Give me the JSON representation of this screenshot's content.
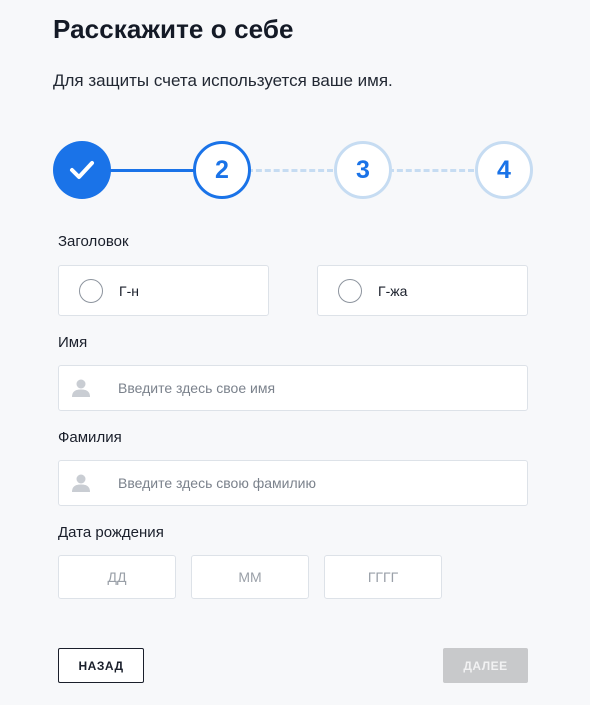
{
  "header": {
    "title": "Расскажите о себе",
    "subtitle": "Для защиты счета используется ваше имя."
  },
  "stepper": {
    "steps": [
      {
        "label": "",
        "state": "completed",
        "icon": "check-icon"
      },
      {
        "label": "2",
        "state": "current"
      },
      {
        "label": "3",
        "state": "upcoming"
      },
      {
        "label": "4",
        "state": "upcoming"
      }
    ],
    "accent_color": "#1a73e8",
    "inactive_color": "#c6dcf2"
  },
  "form": {
    "title_label": "Заголовок",
    "title_options": [
      {
        "label": "Г-н",
        "selected": false
      },
      {
        "label": "Г-жа",
        "selected": false
      }
    ],
    "first_name": {
      "label": "Имя",
      "placeholder": "Введите здесь свое имя",
      "value": "",
      "icon": "person-icon"
    },
    "last_name": {
      "label": "Фамилия",
      "placeholder": "Введите здесь свою фамилию",
      "value": "",
      "icon": "person-icon"
    },
    "birth_date": {
      "label": "Дата рождения",
      "day_placeholder": "ДД",
      "month_placeholder": "ММ",
      "year_placeholder": "ГГГГ"
    }
  },
  "actions": {
    "back_label": "НАЗАД",
    "next_label": "ДАЛЕЕ",
    "next_enabled": false
  }
}
